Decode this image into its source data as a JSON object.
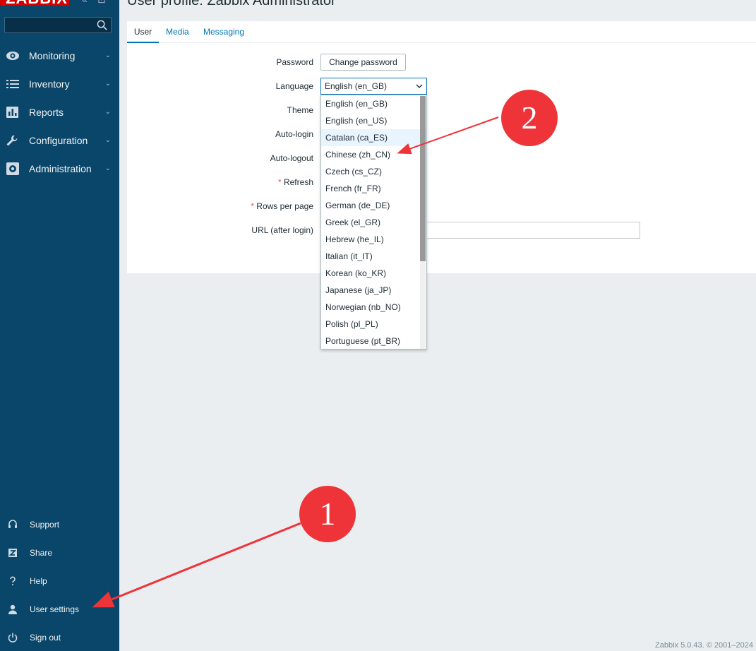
{
  "app": {
    "logo": "ZABBIX",
    "collapse_glyph": "«",
    "kiosk_glyph": "⊡"
  },
  "header": {
    "title": "User profile: Zabbix Administrator"
  },
  "sidebar": {
    "search": {
      "value": "",
      "placeholder": ""
    },
    "menu": [
      {
        "label": "Monitoring",
        "icon": "eye-icon"
      },
      {
        "label": "Inventory",
        "icon": "list-icon"
      },
      {
        "label": "Reports",
        "icon": "bar-chart-icon"
      },
      {
        "label": "Configuration",
        "icon": "wrench-icon"
      },
      {
        "label": "Administration",
        "icon": "gear-icon"
      }
    ],
    "chevron": "⌄",
    "bottom": [
      {
        "label": "Support",
        "icon": "headset-icon"
      },
      {
        "label": "Share",
        "icon": "share-z-icon"
      },
      {
        "label": "Help",
        "icon": "question-icon"
      },
      {
        "label": "User settings",
        "icon": "user-icon"
      },
      {
        "label": "Sign out",
        "icon": "power-icon"
      }
    ]
  },
  "tabs": [
    {
      "label": "User",
      "active": true
    },
    {
      "label": "Media",
      "active": false
    },
    {
      "label": "Messaging",
      "active": false
    }
  ],
  "form": {
    "password_label": "Password",
    "change_password_button": "Change password",
    "language_label": "Language",
    "language_value": "English (en_GB)",
    "theme_label": "Theme",
    "autologin_label": "Auto-login",
    "autologout_label": "Auto-logout",
    "refresh_label": "Refresh",
    "rows_label": "Rows per page",
    "url_label": "URL (after login)",
    "required_mark": "*"
  },
  "language_options": [
    "English (en_GB)",
    "English (en_US)",
    "Catalan (ca_ES)",
    "Chinese (zh_CN)",
    "Czech (cs_CZ)",
    "French (fr_FR)",
    "German (de_DE)",
    "Greek (el_GR)",
    "Hebrew (he_IL)",
    "Italian (it_IT)",
    "Korean (ko_KR)",
    "Japanese (ja_JP)",
    "Norwegian (nb_NO)",
    "Polish (pl_PL)",
    "Portuguese (pt_BR)"
  ],
  "hovered_option": "Catalan (ca_ES)",
  "footer": "Zabbix 5.0.43. © 2001–2024",
  "annotations": {
    "badge1": "1",
    "badge2": "2",
    "color": "#ee3339"
  },
  "colors": {
    "sidebar": "#0a466a",
    "accent": "#0275b8",
    "background": "#ebeef0"
  }
}
